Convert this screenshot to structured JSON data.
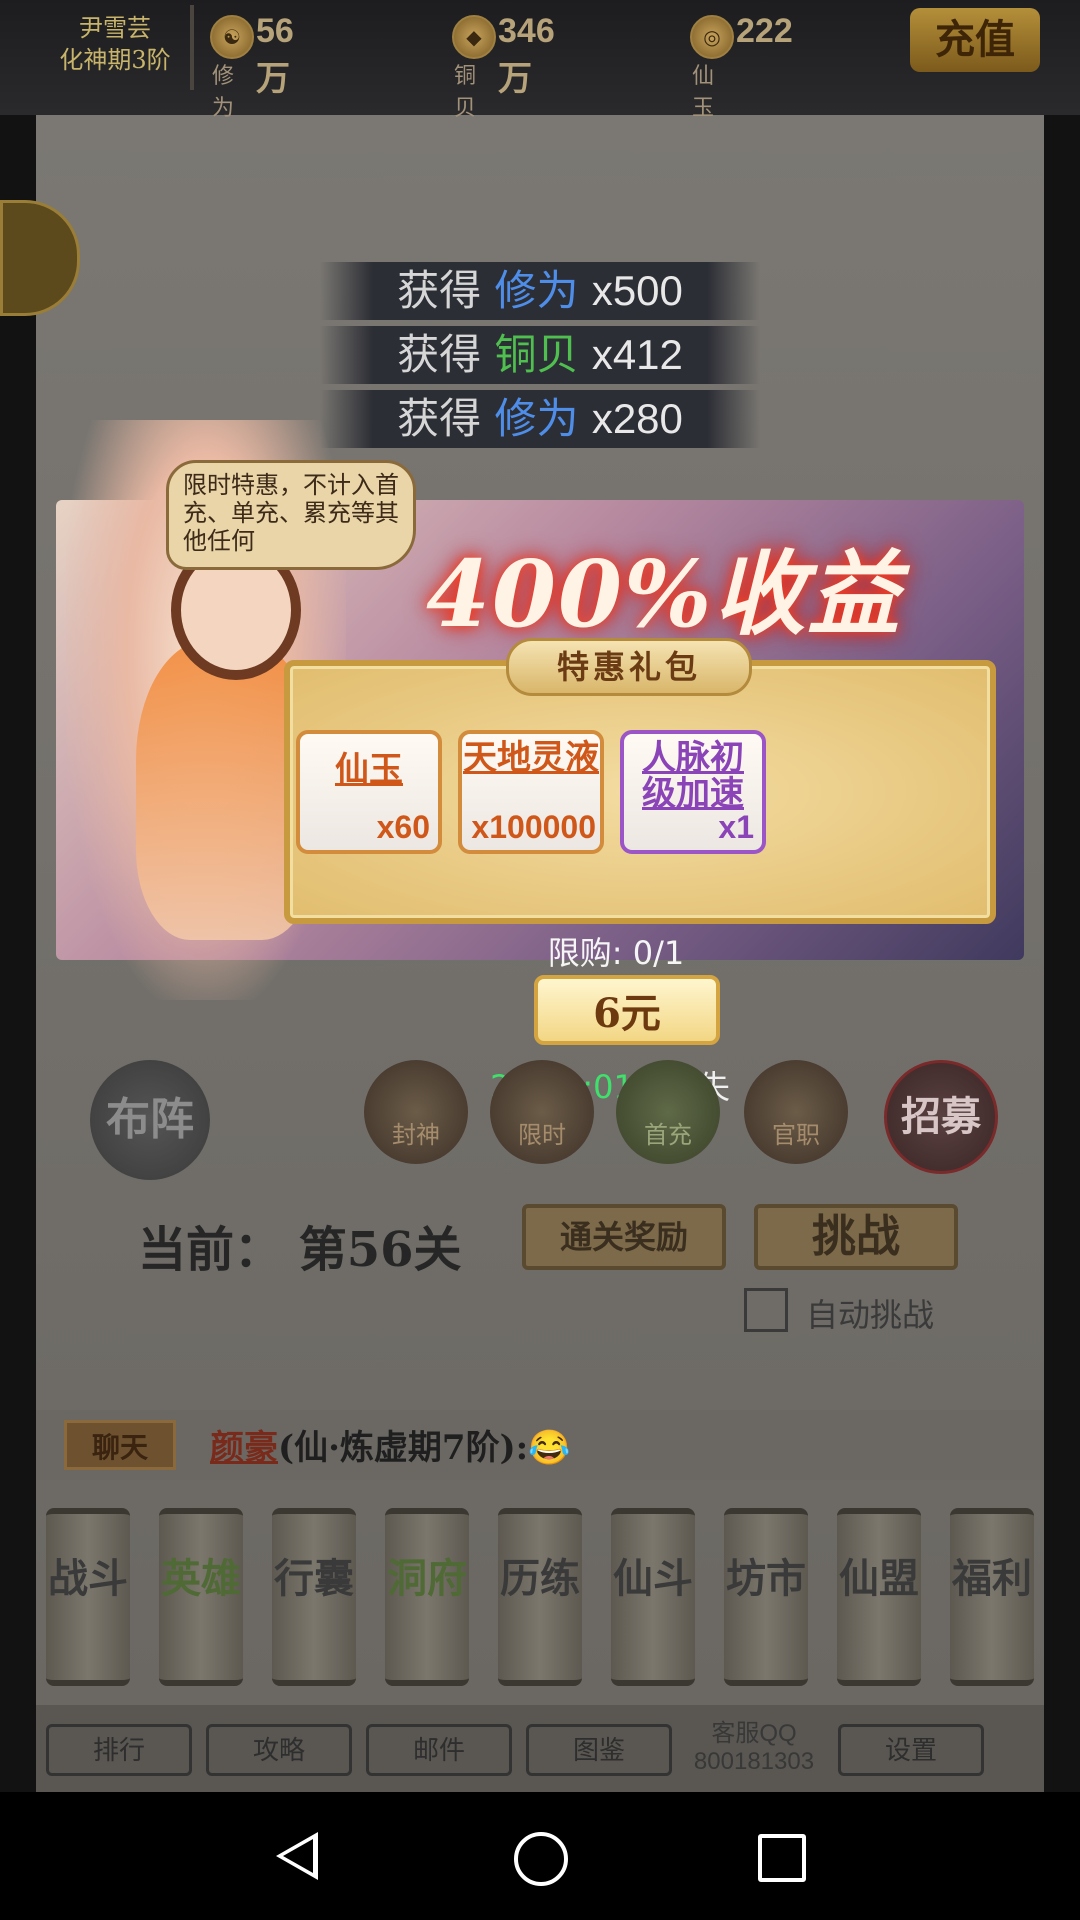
{
  "topbar": {
    "player_name": "尹雪芸",
    "player_rank": "化神期3阶",
    "resources": [
      {
        "icon": "cultivation-icon",
        "value": "56万",
        "label": "修为"
      },
      {
        "icon": "coin-icon",
        "value": "346万",
        "label": "铜贝"
      },
      {
        "icon": "jade-icon",
        "value": "222",
        "label": "仙玉"
      }
    ],
    "recharge_label": "充值"
  },
  "loot": [
    {
      "prefix": "获得",
      "item": "修为",
      "color": "#4f8ee8",
      "qty": "x500"
    },
    {
      "prefix": "获得",
      "item": "铜贝",
      "color": "#4fbf4f",
      "qty": "x412"
    },
    {
      "prefix": "获得",
      "item": "修为",
      "color": "#4f8ee8",
      "qty": "x280"
    }
  ],
  "popup": {
    "bubble_text": "限时特惠，不计入首充、单充、累充等其他任何",
    "big_title": "400%收益",
    "panel_title": "特惠礼包",
    "items": [
      {
        "name": "仙玉",
        "qty": "x60",
        "rarity": "orange"
      },
      {
        "name": "天地灵液",
        "qty": "x100000",
        "rarity": "orange"
      },
      {
        "name": "人脉初级加速",
        "qty": "x1",
        "rarity": "purple"
      }
    ],
    "limit": "限购: 0/1",
    "price": "6元",
    "timer": "23:56:01",
    "timer_suffix": "后消失"
  },
  "background_ui": {
    "buzhen": "布阵",
    "circle_buttons": [
      "封神",
      "限时",
      "首充",
      "官职"
    ],
    "zhaomu": "招募",
    "stage": "当前：  第56关",
    "reward_btn": "通关奖励",
    "challenge_btn": "挑战",
    "auto_label": "自动挑战",
    "chat_tag": "聊天",
    "chat_name": "颜豪",
    "chat_rank": "(仙·炼虚期7阶):😂",
    "scrolls": [
      "战斗",
      "英雄",
      "行囊",
      "洞府",
      "历练",
      "仙斗",
      "坊市",
      "仙盟",
      "福利"
    ],
    "small_buttons": [
      "排行",
      "攻略",
      "邮件",
      "图鉴"
    ],
    "service_label": "客服QQ",
    "service_number": "800181303",
    "settings": "设置"
  }
}
